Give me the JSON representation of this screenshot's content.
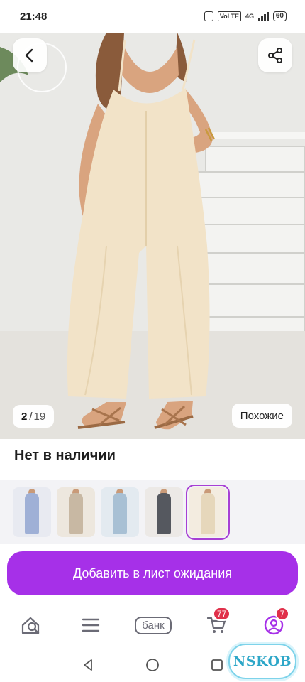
{
  "status_bar": {
    "time": "21:48",
    "volte": "VoLTE",
    "network": "4G",
    "battery": "60"
  },
  "gallery": {
    "current_index": "2",
    "separator": "/",
    "total": "19",
    "similar_label": "Похожие",
    "back_icon": "chevron-left-icon",
    "share_icon": "share-icon"
  },
  "product": {
    "availability": "Нет в наличии"
  },
  "thumbnails": [
    {
      "color": "#e8eaf1",
      "accent": "#9fb0d6",
      "selected": false
    },
    {
      "color": "#ede7de",
      "accent": "#c8b8a3",
      "selected": false
    },
    {
      "color": "#e3eaf0",
      "accent": "#a8c0d4",
      "selected": false
    },
    {
      "color": "#ece9e6",
      "accent": "#55585f",
      "selected": false
    },
    {
      "color": "#f3ece0",
      "accent": "#e6d7bb",
      "selected": true
    }
  ],
  "cta": {
    "label": "Добавить в лист ожидания",
    "color": "#a630e8"
  },
  "bottom_nav": {
    "home_icon": "home-search-icon",
    "catalog_icon": "menu-icon",
    "bank_label": "банк",
    "cart_icon": "cart-icon",
    "cart_badge": "77",
    "profile_icon": "profile-icon",
    "profile_badge": "7"
  },
  "watermark": {
    "text": "NSKOB"
  }
}
